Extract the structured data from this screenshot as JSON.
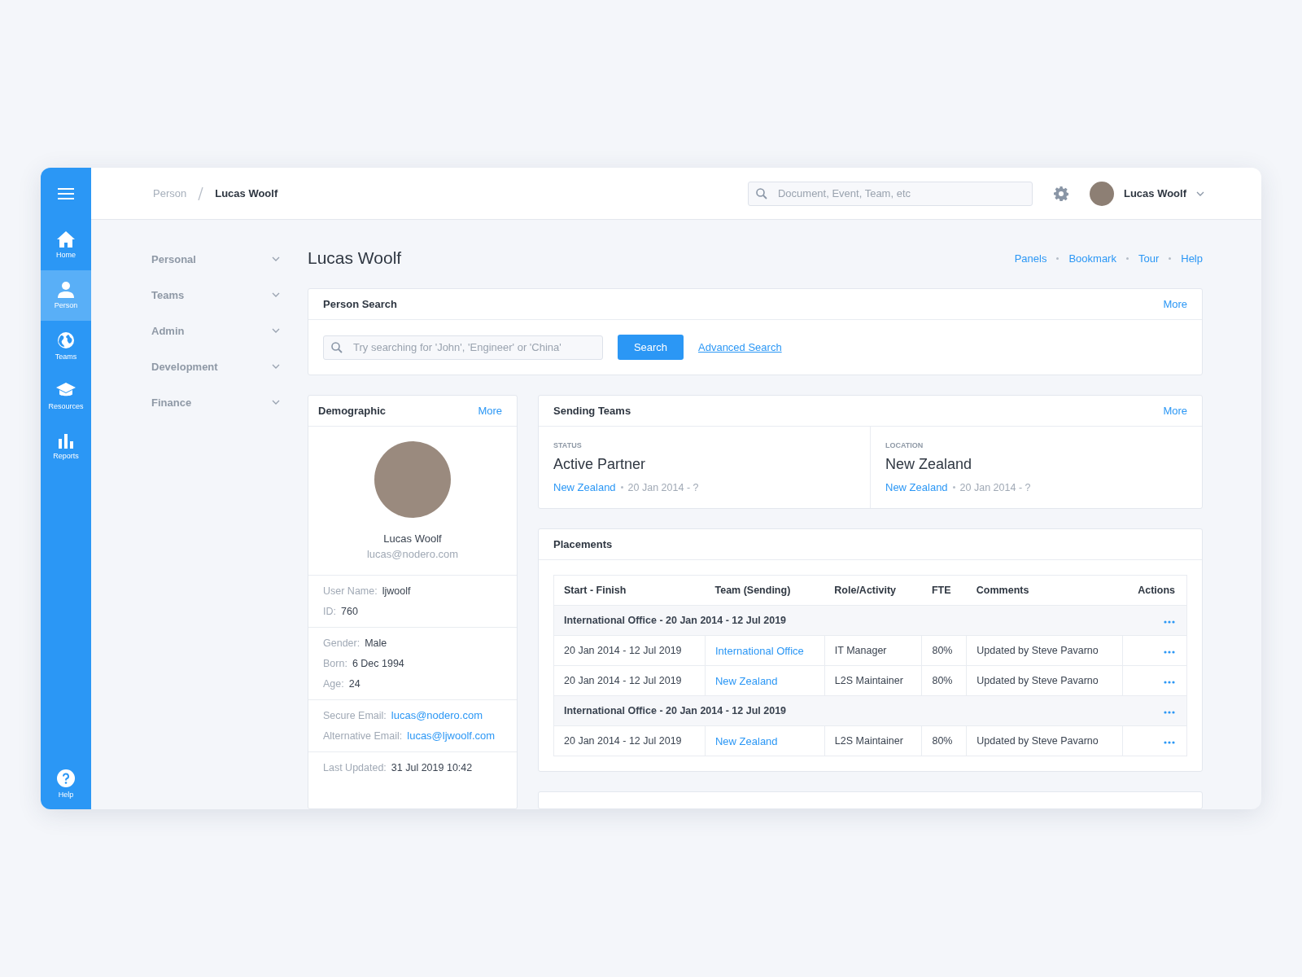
{
  "rail": {
    "items": [
      {
        "label": "Home",
        "selected": false
      },
      {
        "label": "Person",
        "selected": true
      },
      {
        "label": "Teams",
        "selected": false
      },
      {
        "label": "Resources",
        "selected": false
      },
      {
        "label": "Reports",
        "selected": false
      }
    ],
    "help": {
      "label": "Help"
    }
  },
  "topbar": {
    "breadcrumb": [
      "Person",
      "Lucas Woolf"
    ],
    "search": {
      "placeholder": "Document, Event, Team, etc"
    },
    "user": {
      "name": "Lucas Woolf"
    }
  },
  "subnav": [
    {
      "label": "Personal",
      "expanded": false
    },
    {
      "label": "Teams",
      "expanded": false
    },
    {
      "label": "Admin",
      "expanded": false
    },
    {
      "label": "Development",
      "expanded": false
    },
    {
      "label": "Finance",
      "expanded": false
    }
  ],
  "page": {
    "title": "Lucas Woolf",
    "links": [
      "Panels",
      "Bookmark",
      "Tour",
      "Help"
    ]
  },
  "person_search": {
    "title": "Person Search",
    "more": "More",
    "placeholder": "Try searching for 'John', 'Engineer' or 'China'",
    "button": "Search",
    "advanced": "Advanced Search"
  },
  "demographic": {
    "title": "Demographic",
    "more": "More",
    "name": "Lucas Woolf",
    "email": "lucas@nodero.com",
    "sections": [
      [
        {
          "label": "User Name:",
          "value": "ljwoolf",
          "kind": "text"
        },
        {
          "label": "ID:",
          "value": "760",
          "kind": "text"
        }
      ],
      [
        {
          "label": "Gender:",
          "value": "Male",
          "kind": "text"
        },
        {
          "label": "Born:",
          "value": "6 Dec 1994",
          "kind": "text"
        },
        {
          "label": "Age:",
          "value": "24",
          "kind": "text"
        }
      ],
      [
        {
          "label": "Secure Email:",
          "value": "lucas@nodero.com",
          "kind": "link"
        },
        {
          "label": "Alternative Email:",
          "value": "lucas@ljwoolf.com",
          "kind": "link"
        }
      ],
      [
        {
          "label": "Last Updated:",
          "value": "31 Jul 2019 10:42",
          "kind": "text"
        }
      ]
    ]
  },
  "sending_teams": {
    "title": "Sending Teams",
    "more": "More",
    "panels": [
      {
        "caption": "STATUS",
        "value": "Active Partner",
        "link": "New Zealand",
        "date": "20 Jan 2014 - ?"
      },
      {
        "caption": "LOCATION",
        "value": "New Zealand",
        "link": "New Zealand",
        "date": "20 Jan 2014 - ?"
      }
    ]
  },
  "placements": {
    "title": "Placements",
    "columns": [
      "Start - Finish",
      "Team (Sending)",
      "Role/Activity",
      "FTE",
      "Comments",
      "Actions"
    ],
    "rows": [
      {
        "kind": "group",
        "label": "International Office - 20 Jan 2014 - 12 Jul 2019"
      },
      {
        "kind": "row",
        "cells": [
          "20 Jan 2014 - 12 Jul 2019",
          "International Office",
          "IT Manager",
          "80%",
          "Updated by Steve Pavarno"
        ]
      },
      {
        "kind": "row",
        "cells": [
          "20 Jan 2014 - 12 Jul 2019",
          "New Zealand",
          "L2S Maintainer",
          "80%",
          "Updated by Steve Pavarno"
        ]
      },
      {
        "kind": "group",
        "label": "International Office - 20 Jan 2014 - 12 Jul 2019"
      },
      {
        "kind": "row",
        "cells": [
          "20 Jan 2014 - 12 Jul 2019",
          "New Zealand",
          "L2S Maintainer",
          "80%",
          "Updated by Steve Pavarno"
        ]
      }
    ]
  }
}
